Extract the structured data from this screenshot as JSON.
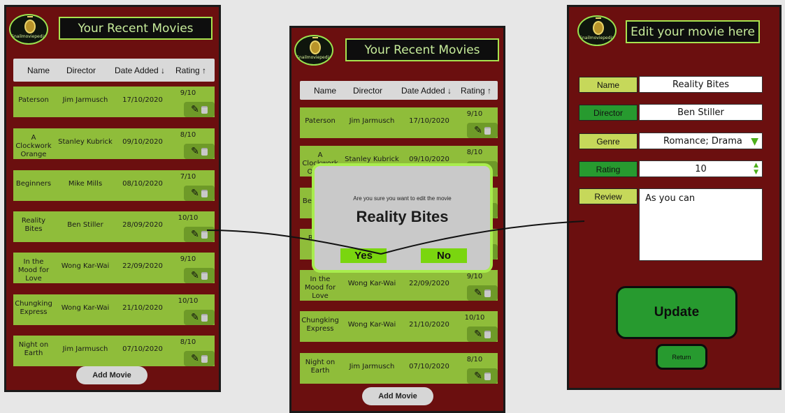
{
  "brand": {
    "logo_text": "Snailmoviepedia"
  },
  "list": {
    "title": "Your Recent Movies",
    "columns": [
      "Name",
      "Director",
      "Date Added ↓",
      "Rating ↑"
    ],
    "movies": [
      {
        "name": "Paterson",
        "director": "Jim Jarmusch",
        "date": "17/10/2020",
        "rating": "9/10"
      },
      {
        "name": "A Clockwork Orange",
        "director": "Stanley Kubrick",
        "date": "09/10/2020",
        "rating": "8/10"
      },
      {
        "name": "Beginners",
        "director": "Mike Mills",
        "date": "08/10/2020",
        "rating": "7/10"
      },
      {
        "name": "Reality Bites",
        "director": "Ben Stiller",
        "date": "28/09/2020",
        "rating": "10/10"
      },
      {
        "name": "In the Mood for Love",
        "director": "Wong Kar-Wai",
        "date": "22/09/2020",
        "rating": "9/10"
      },
      {
        "name": "Chungking Express",
        "director": "Wong Kar-Wai",
        "date": "21/10/2020",
        "rating": "10/10"
      },
      {
        "name": "Night on Earth",
        "director": "Jim Jarmusch",
        "date": "07/10/2020",
        "rating": "8/10"
      }
    ],
    "add_label": "Add Movie"
  },
  "modal": {
    "question": "Are you sure you want to edit the movie",
    "movie": "Reality Bites",
    "yes": "Yes",
    "no": "No"
  },
  "edit": {
    "title": "Edit your movie here",
    "fields": {
      "name": {
        "label": "Name",
        "value": "Reality Bites"
      },
      "director": {
        "label": "Director",
        "value": "Ben Stiller"
      },
      "genre": {
        "label": "Genre",
        "value": "Romance; Drama"
      },
      "rating": {
        "label": "Rating",
        "value": "10"
      },
      "review": {
        "label": "Review",
        "value": "As you can"
      }
    },
    "update_label": "Update",
    "return_label": "Return"
  },
  "colors": {
    "screen_bg": "#6b0f0f",
    "row_green": "#8fbd3a",
    "accent_lime": "#a8ec4d",
    "button_green": "#279a2f"
  }
}
